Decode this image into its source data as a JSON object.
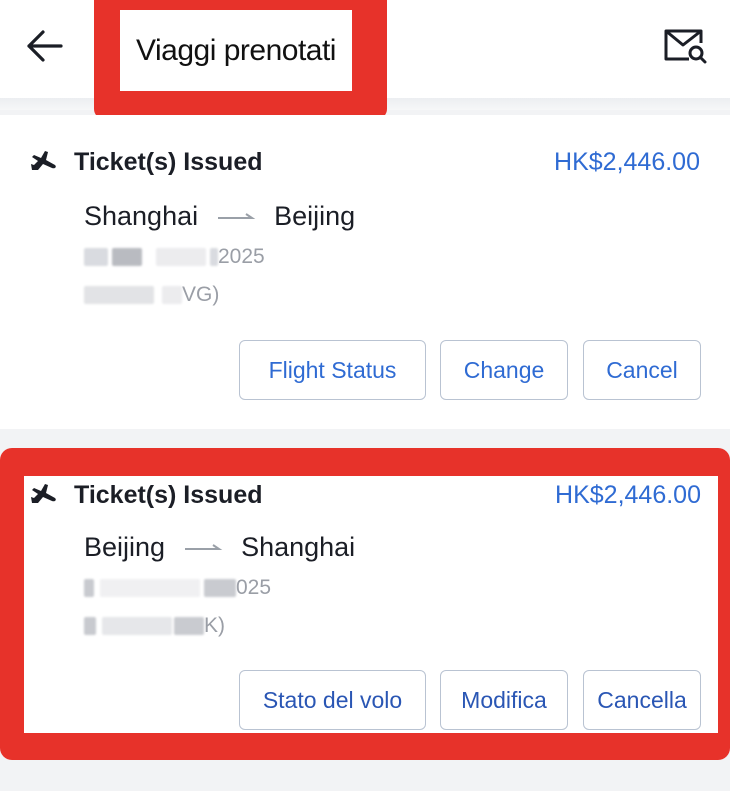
{
  "header": {
    "title": "Viaggi prenotati",
    "back_icon": "arrow-left-icon",
    "mail_icon": "mail-search-icon"
  },
  "colors": {
    "accent": "#2f6bd3",
    "highlight": "#e7322a"
  },
  "trips": [
    {
      "status": "Ticket(s) Issued",
      "price": "HK$2,446.00",
      "origin": "Shanghai",
      "destination": "Beijing",
      "date_partial": "2025",
      "code_partial": "VG)",
      "buttons": {
        "status": "Flight Status",
        "change": "Change",
        "cancel": "Cancel"
      }
    },
    {
      "status": "Ticket(s) Issued",
      "price": "HK$2,446.00",
      "origin": "Beijing",
      "destination": "Shanghai",
      "date_partial": "025",
      "code_partial": "K)",
      "buttons": {
        "status": "Stato del volo",
        "change": "Modifica",
        "cancel": "Cancella"
      }
    }
  ]
}
